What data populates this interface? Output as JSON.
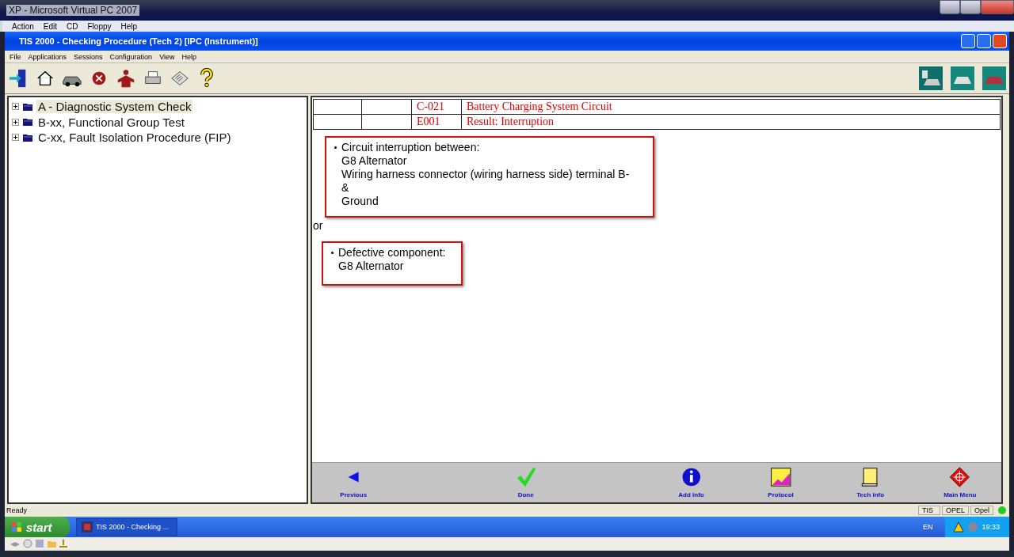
{
  "host_window": {
    "title": "XP - Microsoft Virtual PC 2007",
    "menu": [
      "Action",
      "Edit",
      "CD",
      "Floppy",
      "Help"
    ]
  },
  "app_window": {
    "title": "TIS 2000 - Checking Procedure (Tech 2) [IPC (Instrument)]",
    "menu": [
      "File",
      "Applications",
      "Sessions",
      "Configuration",
      "View",
      "Help"
    ]
  },
  "tree": [
    {
      "label": "A - Diagnostic System Check",
      "selected": true,
      "expanded": false
    },
    {
      "label": "B-xx, Functional Group Test",
      "selected": false,
      "expanded": false
    },
    {
      "label": "C-xx, Fault Isolation Procedure (FIP)",
      "selected": false,
      "expanded": false
    }
  ],
  "table": {
    "rows": [
      {
        "code": "C-021",
        "text": "Battery Charging System Circuit"
      },
      {
        "code": "E001",
        "text": "Result: Interruption"
      }
    ]
  },
  "findings": [
    {
      "heading": "Circuit interruption between:",
      "lines": [
        "G8 Alternator",
        "Wiring harness connector (wiring harness side) terminal B-",
        "&",
        "Ground"
      ]
    },
    {
      "heading": "Defective component:",
      "lines": [
        "G8 Alternator"
      ]
    }
  ],
  "separator": "or",
  "nav_buttons": [
    {
      "label": "Previous",
      "kind": "previous"
    },
    {
      "label": "Done",
      "kind": "done"
    },
    {
      "label": "Add Info",
      "kind": "info"
    },
    {
      "label": "Protocol",
      "kind": "protocol"
    },
    {
      "label": "Tech Info",
      "kind": "techinfo"
    },
    {
      "label": "Main Menu",
      "kind": "mainmenu"
    }
  ],
  "status_bar": {
    "text": "Ready",
    "panes": [
      "TIS",
      "OPEL",
      "Opel"
    ],
    "online": true
  },
  "taskbar": {
    "start": "start",
    "task": "TIS 2000 - Checking ...",
    "language": "EN",
    "clock": "19:33"
  }
}
